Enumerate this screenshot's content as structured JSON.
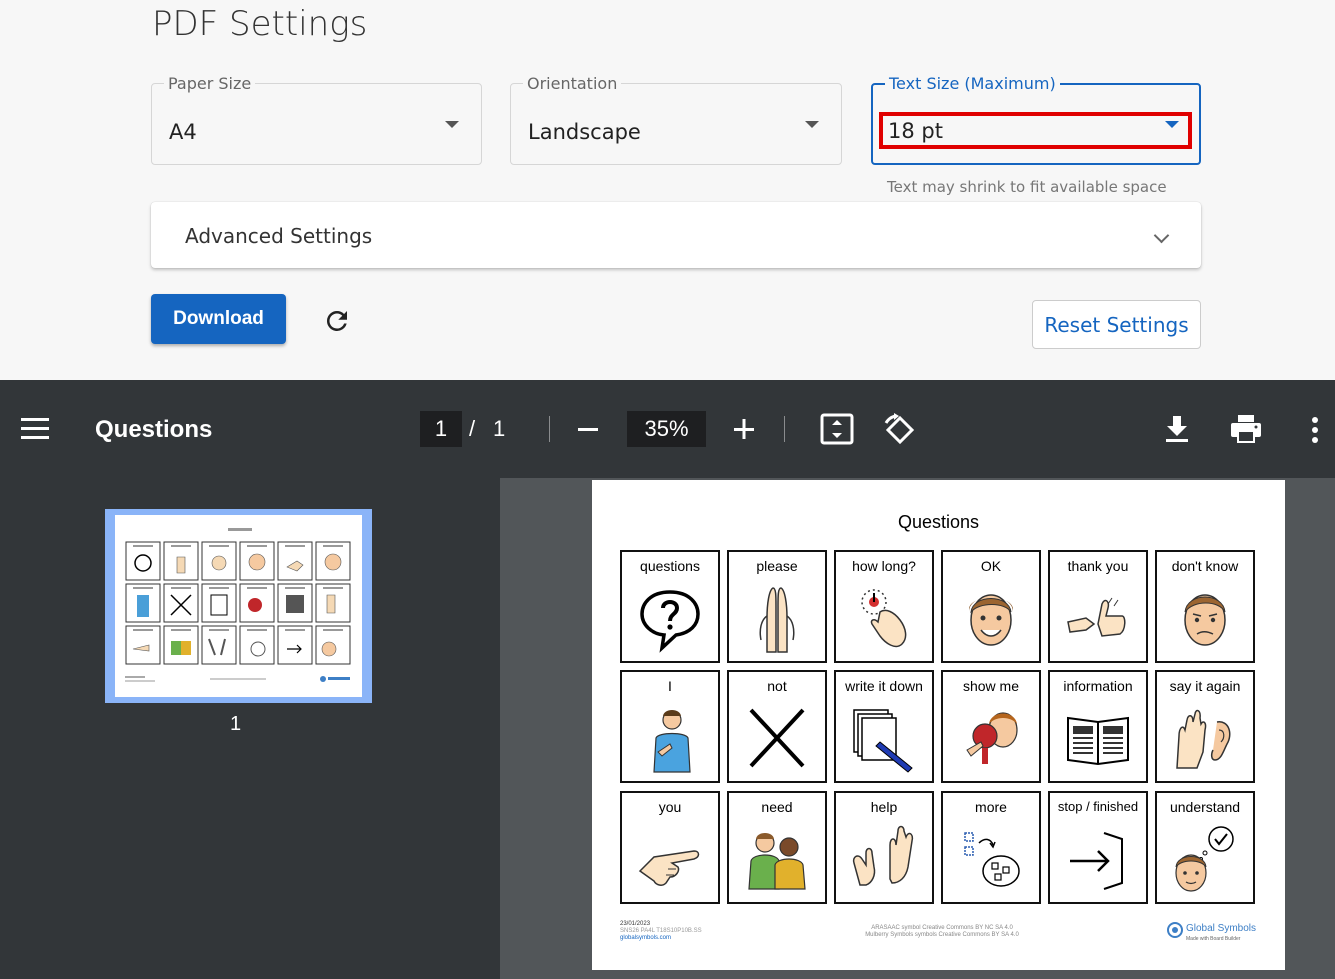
{
  "settings": {
    "title": "PDF Settings",
    "paper_size": {
      "label": "Paper Size",
      "value": "A4"
    },
    "orientation": {
      "label": "Orientation",
      "value": "Landscape"
    },
    "text_size": {
      "label": "Text Size (Maximum)",
      "value": "18 pt",
      "helper": "Text may shrink to fit available space"
    },
    "advanced_label": "Advanced Settings",
    "download_label": "Download",
    "reset_label": "Reset Settings"
  },
  "viewer": {
    "doc_title": "Questions",
    "current_page": "1",
    "separator": "/",
    "total_pages": "1",
    "zoom": "35%",
    "thumbnail_page": "1"
  },
  "board": {
    "title": "Questions",
    "rows": [
      [
        {
          "label": "questions",
          "icon": "speech-question-icon"
        },
        {
          "label": "please",
          "icon": "praying-hands-icon"
        },
        {
          "label": "how long?",
          "icon": "stopwatch-hand-icon"
        },
        {
          "label": "OK",
          "icon": "smiling-face-icon"
        },
        {
          "label": "thank you",
          "icon": "thumbs-up-icon"
        },
        {
          "label": "don't know",
          "icon": "unsure-face-icon"
        }
      ],
      [
        {
          "label": "I",
          "icon": "person-pointing-self-icon"
        },
        {
          "label": "not",
          "icon": "cross-icon"
        },
        {
          "label": "write it down",
          "icon": "paper-pen-icon"
        },
        {
          "label": "show me",
          "icon": "show-me-icon"
        },
        {
          "label": "information",
          "icon": "open-book-icon"
        },
        {
          "label": "say it again",
          "icon": "hand-ear-icon"
        }
      ],
      [
        {
          "label": "you",
          "icon": "pointing-hand-icon"
        },
        {
          "label": "need",
          "icon": "two-people-icon"
        },
        {
          "label": "help",
          "icon": "helping-hands-icon"
        },
        {
          "label": "more",
          "icon": "more-shapes-icon"
        },
        {
          "label": "stop / finished",
          "icon": "exit-arrow-icon"
        },
        {
          "label": "understand",
          "icon": "face-check-icon"
        }
      ]
    ],
    "footer": {
      "date": "23/01/2023",
      "code": "SNS26 PA4L T18S10P10B.SS",
      "site": "globalsymbols.com",
      "license_1": "ARASAAC symbol Creative Commons BY NC SA 4.0",
      "license_2": "Mulberry Symbols symbols Creative Commons BY SA 4.0",
      "brand": "Global Symbols",
      "brand_sub": "Made with Board Builder"
    }
  },
  "colors": {
    "accent": "#1565c0",
    "highlight": "#e00000",
    "toolbar": "#323639",
    "viewer_bg": "#525659"
  }
}
